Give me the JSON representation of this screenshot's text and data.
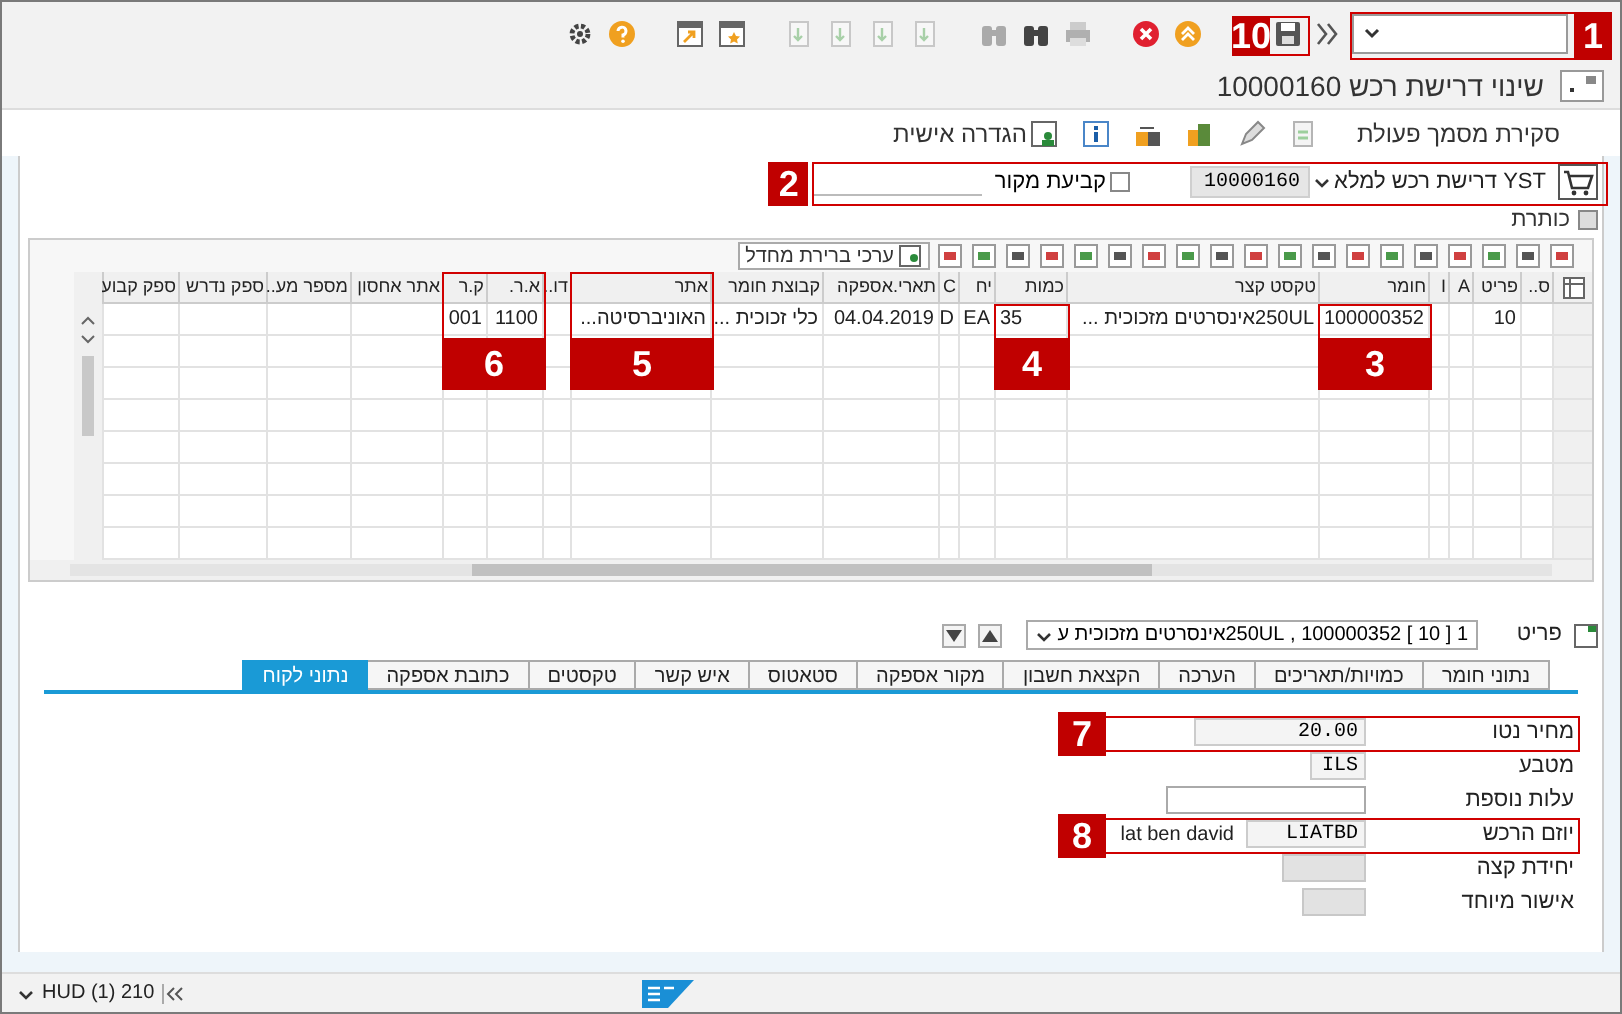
{
  "toolbar": {
    "command_field": {
      "kind": "dropdown"
    }
  },
  "title": "שינוי דרישת רכש 10000160",
  "app_toolbar": {
    "buttons": [
      "סקירת מסמך פעולת",
      "הגדרה אישית"
    ]
  },
  "header_row": {
    "document_type": "YST דרישת רכש למלא",
    "document_number": "10000160",
    "source_determination": {
      "label": "קביעת מקור",
      "checked": false
    }
  },
  "header_section": {
    "label": "כותרת"
  },
  "grid_toolbar": {
    "defaults_button": "ערכי ברירת מחדל"
  },
  "table": {
    "columns": [
      "ס..",
      "פריט",
      "A",
      "I",
      "חומר",
      "טקסט קצר",
      "כמות",
      "יח",
      "C",
      "תארי.אספקה",
      "קבוצת חומר",
      "אתר",
      "דו..",
      "א.ר.",
      "ק.ר",
      "אתר אחסון",
      "מספר מע..",
      "ספק נדרש",
      "ספק קבוע"
    ],
    "rows": [
      {
        "cells": [
          null,
          "10",
          null,
          null,
          "100000352",
          "250ULאינסרטים מזכוכית ...",
          "35",
          "EA",
          "D",
          "04.04.2019",
          "כלי זכוכית ...",
          "האוניברסיטה...",
          null,
          "1100",
          "001",
          null,
          null,
          null,
          null
        ]
      }
    ]
  },
  "item_selector": {
    "label": "פריט",
    "value": "1 [ 10 ] 100000352 , 250ULאינסרטים מזכוכית ע"
  },
  "tabs": [
    {
      "label": "נתוני חומר",
      "selected": false
    },
    {
      "label": "כמויות/תאריכים",
      "selected": false
    },
    {
      "label": "הערכה",
      "selected": false
    },
    {
      "label": "הקצאת חשבון",
      "selected": false
    },
    {
      "label": "מקור אספקה",
      "selected": false
    },
    {
      "label": "סטאטוס",
      "selected": false
    },
    {
      "label": "איש קשר",
      "selected": false
    },
    {
      "label": "טקסטים",
      "selected": false
    },
    {
      "label": "כתובת אספקה",
      "selected": false
    },
    {
      "label": "נתוני לקוח",
      "selected": true
    }
  ],
  "form": [
    {
      "label": "מחיר נטו",
      "value": "20.00",
      "kind": "wide"
    },
    {
      "label": "מטבע",
      "value": "ILS",
      "kind": "short"
    },
    {
      "label": "עלות נוספת",
      "kind": "medium"
    },
    {
      "label": "יוזם הרכש",
      "value": "LIATBD",
      "extra": "lat ben david",
      "kind": "user"
    },
    {
      "label": "יחידת קצה",
      "kind": "disabled"
    },
    {
      "label": "אישור מיוחד",
      "kind": "disabled_small"
    }
  ],
  "status_bar": {
    "system": "HUD (1) 210"
  },
  "callouts": [
    {
      "label": "1"
    },
    {
      "label": "10"
    },
    {
      "label": "2"
    },
    {
      "label": "3"
    },
    {
      "label": "4"
    },
    {
      "label": "5"
    },
    {
      "label": "6"
    },
    {
      "label": "7"
    },
    {
      "label": "8"
    }
  ]
}
